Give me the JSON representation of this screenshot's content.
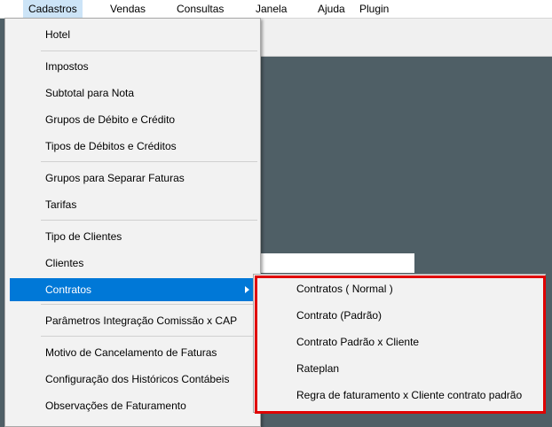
{
  "menubar": {
    "items": [
      {
        "label": "Cadastros"
      },
      {
        "label": "Vendas"
      },
      {
        "label": "Consultas"
      },
      {
        "label": "Janela"
      },
      {
        "label": "Ajuda"
      },
      {
        "label": "Plugin"
      }
    ]
  },
  "dropdown": {
    "items": [
      {
        "label": "Hotel"
      },
      {
        "label": "Impostos"
      },
      {
        "label": "Subtotal para Nota"
      },
      {
        "label": "Grupos de Débito e Crédito"
      },
      {
        "label": "Tipos de Débitos e Créditos"
      },
      {
        "label": "Grupos para Separar Faturas"
      },
      {
        "label": "Tarifas"
      },
      {
        "label": "Tipo de Clientes"
      },
      {
        "label": "Clientes"
      },
      {
        "label": "Contratos"
      },
      {
        "label": "Parâmetros Integração Comissão x CAP"
      },
      {
        "label": "Motivo de Cancelamento de Faturas"
      },
      {
        "label": "Configuração dos Históricos Contábeis"
      },
      {
        "label": "Observações de Faturamento"
      }
    ]
  },
  "submenu": {
    "items": [
      {
        "label": "Contratos ( Normal )"
      },
      {
        "label": "Contrato (Padrão)"
      },
      {
        "label": "Contrato Padrão x Cliente"
      },
      {
        "label": "Rateplan"
      },
      {
        "label": "Regra de faturamento x Cliente contrato padrão"
      }
    ]
  },
  "colors": {
    "highlight": "#0078d7",
    "annotation_border": "#e00000",
    "background": "#4f5f66"
  }
}
